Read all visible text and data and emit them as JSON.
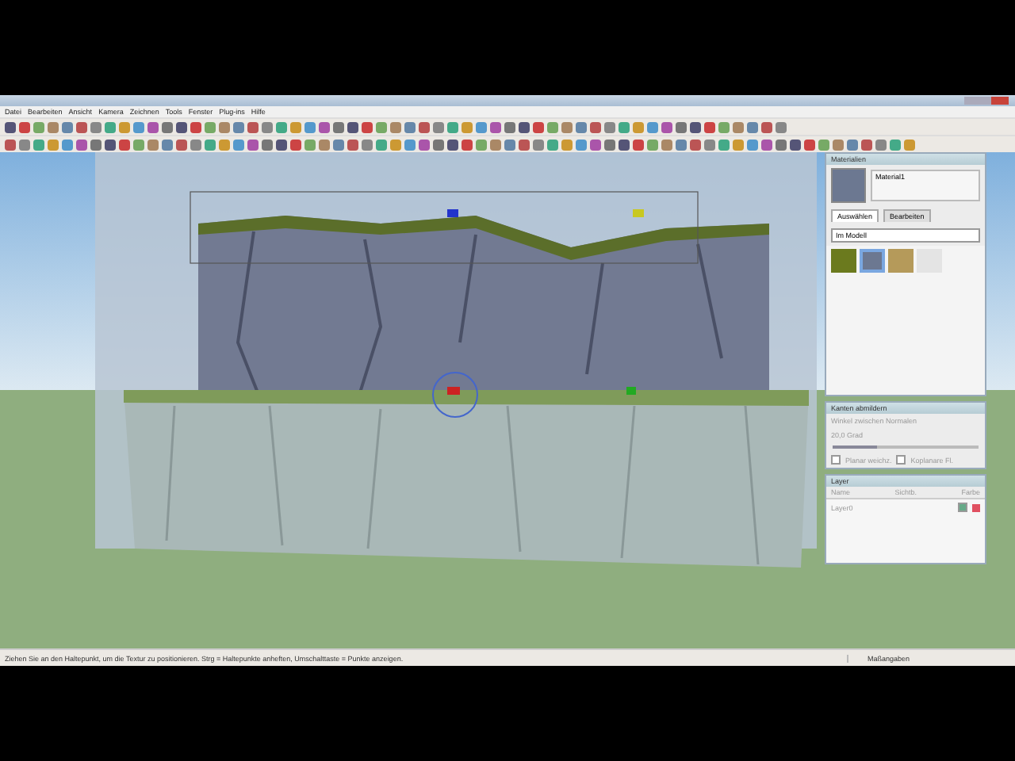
{
  "menu": [
    "Datei",
    "Bearbeiten",
    "Ansicht",
    "Kamera",
    "Zeichnen",
    "Tools",
    "Fenster",
    "Plug-ins",
    "Hilfe"
  ],
  "materials": {
    "title": "Materialien",
    "name": "Material1",
    "tabs": [
      {
        "label": "Auswählen",
        "selected": true
      },
      {
        "label": "Bearbeiten",
        "selected": false
      }
    ],
    "collection": "Im Modell",
    "swatches": [
      {
        "color": "#6b7a1e",
        "selected": false
      },
      {
        "color": "#6c7891",
        "selected": true
      },
      {
        "color": "#b59a5a",
        "selected": false
      },
      {
        "color": "#e4e4e4",
        "selected": false
      }
    ]
  },
  "smooth_edges": {
    "title": "Kanten abmildern",
    "label": "Winkel zwischen Normalen",
    "reading": "20,0 Grad",
    "level": 0.3,
    "options": [
      {
        "label": "Planar weichz.",
        "checked": false
      },
      {
        "label": "Koplanare Fl.",
        "checked": false
      }
    ]
  },
  "layers": {
    "title": "Layer",
    "columns": [
      "Name",
      "Sichtb.",
      "Farbe"
    ],
    "rows": [
      {
        "name": "Layer0",
        "visible": true,
        "color": "#e05060"
      }
    ]
  },
  "status": {
    "text": "Ziehen Sie an den Haltepunkt, um die Textur zu positionieren. Strg = Haltepunkte anheften, Umschalttaste = Punkte anzeigen.",
    "measurements": "Maßangaben"
  }
}
